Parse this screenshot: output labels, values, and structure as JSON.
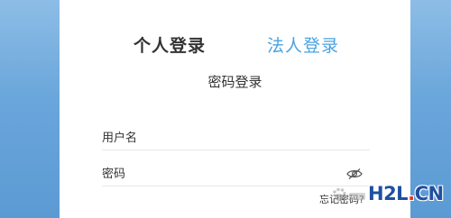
{
  "tabs": {
    "personal_label": "个人登录",
    "corporate_label": "法人登录"
  },
  "login": {
    "subtitle": "密码登录",
    "username_placeholder": "用户名",
    "password_placeholder": "密码",
    "forgot_label": "忘记密码?"
  },
  "watermark": {
    "brand_prefix": "H2L",
    "brand_dot": ".",
    "brand_suffix": "CN",
    "icon": "baidu-jingyan-paw-icon"
  },
  "colors": {
    "background": "#6aa6db",
    "active_tab": "#333333",
    "link_tab": "#4aa3e0",
    "brand_blue": "#1f4fa0",
    "brand_red": "#e0362c"
  }
}
